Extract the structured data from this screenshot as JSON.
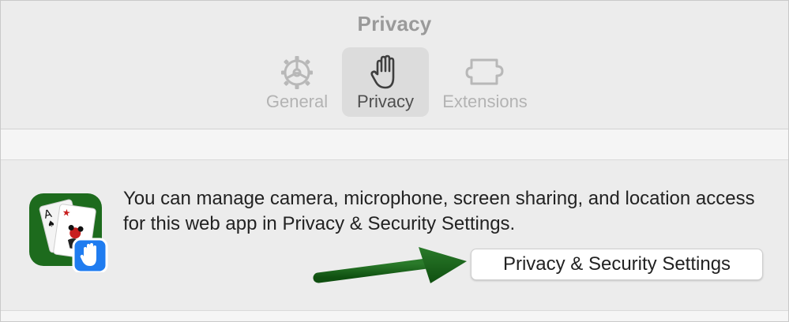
{
  "window": {
    "title": "Privacy"
  },
  "tabs": [
    {
      "label": "General",
      "icon": "gear-icon",
      "selected": false
    },
    {
      "label": "Privacy",
      "icon": "hand-icon",
      "selected": true
    },
    {
      "label": "Extensions",
      "icon": "puzzle-piece-icon",
      "selected": false
    }
  ],
  "content": {
    "app_icon": "solitaire-cards-app-icon",
    "badge_icon": "hand-icon",
    "message": "You can manage camera, microphone, screen sharing, and location access for this web app in Privacy & Security Settings.",
    "button_label": "Privacy & Security Settings"
  },
  "colors": {
    "app_icon_green": "#1d6b1d",
    "badge_blue": "#1f7cf0",
    "arrow_green": "#196019",
    "selected_tab_bg": "#dcdcdc"
  }
}
